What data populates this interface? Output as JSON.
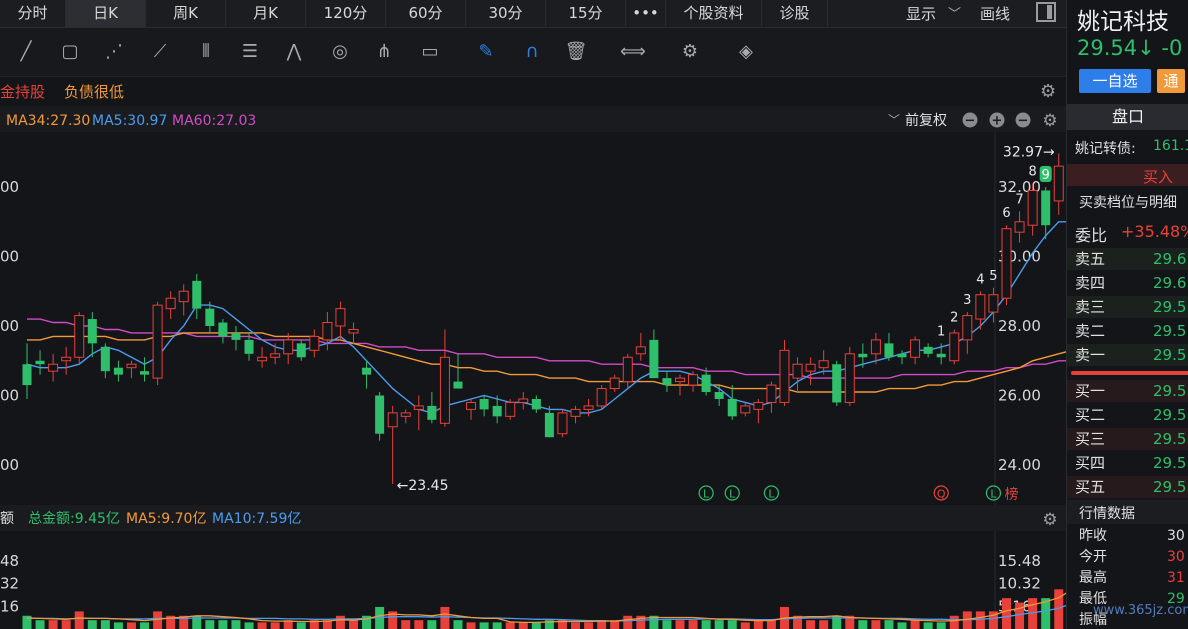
{
  "tabs": [
    {
      "label": "分时",
      "active": false
    },
    {
      "label": "日K",
      "active": true
    },
    {
      "label": "周K",
      "active": false
    },
    {
      "label": "月K",
      "active": false
    },
    {
      "label": "120分",
      "active": false
    },
    {
      "label": "60分",
      "active": false
    },
    {
      "label": "30分",
      "active": false
    },
    {
      "label": "15分",
      "active": false
    },
    {
      "label": "•••",
      "active": false
    },
    {
      "label": "个股资料",
      "active": false
    },
    {
      "label": "诊股",
      "active": false
    }
  ],
  "toolbar_right": {
    "display_label": "显示",
    "draw_label": "画线"
  },
  "tools": [
    "line-tool-icon",
    "rect-tool-icon",
    "fan-tool-icon",
    "node-tool-icon",
    "bars-tool-icon",
    "text-box-tool-icon",
    "wave-tool-icon",
    "cycle-tool-icon",
    "fork-tool-icon",
    "note-tool-icon",
    "pen-icon",
    "magnet-icon",
    "trash-icon",
    "mirror-icon",
    "settings-icon",
    "layers-icon"
  ],
  "tags": {
    "tag1": "金持股",
    "tag2": "负债很低"
  },
  "ma_legend": {
    "ma34": "MA34:27.30",
    "ma5": "MA5:30.97",
    "ma60": "MA60:27.03",
    "adjust": "前复权"
  },
  "price_axis": {
    "left": [
      "00",
      "00",
      "00",
      "00",
      "00"
    ],
    "right": [
      "32.00",
      "30.00",
      "28.00",
      "26.00",
      "24.00"
    ]
  },
  "annotations": {
    "high": "32.97→",
    "low": "←23.45",
    "seq": [
      "1",
      "2",
      "3",
      "4",
      "5",
      "6",
      "7",
      "8",
      "9"
    ],
    "markers": [
      "L",
      "L",
      "L",
      "Q",
      "L"
    ],
    "bang": "榜"
  },
  "volume": {
    "title": "额",
    "total": "总金额:9.45亿",
    "ma5": "MA5:9.70亿",
    "ma10": "MA10:7.59亿",
    "left_axis": [
      "48",
      "32",
      "16"
    ],
    "right_axis": [
      "15.48",
      "10.32",
      "5.16"
    ]
  },
  "right_panel": {
    "stock_name": "姚记科技",
    "price": "29.54↓ -0",
    "watch_button": "一自选",
    "tong": "通",
    "pankou": "盘口",
    "bond_label": "姚记转债:",
    "bond_value": "161.1",
    "buy_in": "买入",
    "depth_title": "买卖档位与明细",
    "weibi_label": "委比",
    "weibi_value": "+35.48%",
    "asks": [
      {
        "label": "卖五",
        "value": "29.6"
      },
      {
        "label": "卖四",
        "value": "29.6"
      },
      {
        "label": "卖三",
        "value": "29.5"
      },
      {
        "label": "卖二",
        "value": "29.5"
      },
      {
        "label": "卖一",
        "value": "29.5"
      }
    ],
    "bids": [
      {
        "label": "买一",
        "value": "29.5"
      },
      {
        "label": "买二",
        "value": "29.5"
      },
      {
        "label": "买三",
        "value": "29.5"
      },
      {
        "label": "买四",
        "value": "29.5"
      },
      {
        "label": "买五",
        "value": "29.5"
      }
    ],
    "stats_title": "行情数据",
    "stats": [
      {
        "label": "昨收",
        "value": "30"
      },
      {
        "label": "今开",
        "value": "30"
      },
      {
        "label": "最高",
        "value": "31"
      },
      {
        "label": "最低",
        "value": "29"
      },
      {
        "label": "振幅",
        "value": ""
      }
    ]
  },
  "watermark": "www.365jz.com",
  "colors": {
    "up": "#e8413b",
    "down": "#2fbf6b",
    "ma5": "#4a9df0",
    "ma34": "#f29a3a",
    "ma60": "#d04cc5",
    "accent": "#2d7ee8"
  },
  "chart_data": {
    "type": "candlestick",
    "candles": [
      [
        26.9,
        27.5,
        25.9,
        26.3
      ],
      [
        27.0,
        27.3,
        26.6,
        26.9
      ],
      [
        26.7,
        27.2,
        26.4,
        26.9
      ],
      [
        27.0,
        27.4,
        26.6,
        27.1
      ],
      [
        27.1,
        28.4,
        26.9,
        28.3
      ],
      [
        28.2,
        28.4,
        27.1,
        27.5
      ],
      [
        27.4,
        27.5,
        26.5,
        26.7
      ],
      [
        26.8,
        27.0,
        26.4,
        26.6
      ],
      [
        26.8,
        27.0,
        26.5,
        26.9
      ],
      [
        26.7,
        27.1,
        26.4,
        26.6
      ],
      [
        26.5,
        28.7,
        26.3,
        28.6
      ],
      [
        28.5,
        29.0,
        28.2,
        28.8
      ],
      [
        28.7,
        29.2,
        28.3,
        29.0
      ],
      [
        29.3,
        29.5,
        28.2,
        28.5
      ],
      [
        28.5,
        28.7,
        27.8,
        28.0
      ],
      [
        28.1,
        28.2,
        27.5,
        27.7
      ],
      [
        27.8,
        28.0,
        27.3,
        27.6
      ],
      [
        27.6,
        27.8,
        27.0,
        27.2
      ],
      [
        27.0,
        27.4,
        26.8,
        27.1
      ],
      [
        27.1,
        27.5,
        26.9,
        27.2
      ],
      [
        27.2,
        27.8,
        26.9,
        27.6
      ],
      [
        27.5,
        27.6,
        27.0,
        27.1
      ],
      [
        27.3,
        27.9,
        27.1,
        27.7
      ],
      [
        27.6,
        28.4,
        27.3,
        28.1
      ],
      [
        28.0,
        28.7,
        27.6,
        28.5
      ],
      [
        27.8,
        28.1,
        27.5,
        27.9
      ],
      [
        26.8,
        27.0,
        26.2,
        26.6
      ],
      [
        26.0,
        26.1,
        24.7,
        24.9
      ],
      [
        25.1,
        25.7,
        23.45,
        25.5
      ],
      [
        25.4,
        25.6,
        25.2,
        25.5
      ],
      [
        25.6,
        26.0,
        25.0,
        25.7
      ],
      [
        25.7,
        26.1,
        25.2,
        25.3
      ],
      [
        25.2,
        27.9,
        25.1,
        27.1
      ],
      [
        26.4,
        27.2,
        26.2,
        26.2
      ],
      [
        25.6,
        25.9,
        25.3,
        25.8
      ],
      [
        25.9,
        26.0,
        25.4,
        25.6
      ],
      [
        25.7,
        26.0,
        25.2,
        25.4
      ],
      [
        25.4,
        25.9,
        25.3,
        25.8
      ],
      [
        25.8,
        26.1,
        25.6,
        25.9
      ],
      [
        25.9,
        26.0,
        25.5,
        25.6
      ],
      [
        25.5,
        25.7,
        24.8,
        24.8
      ],
      [
        24.9,
        25.6,
        24.8,
        25.5
      ],
      [
        25.4,
        25.7,
        25.2,
        25.6
      ],
      [
        25.6,
        25.9,
        25.4,
        25.7
      ],
      [
        25.7,
        26.3,
        25.6,
        26.2
      ],
      [
        26.2,
        26.6,
        26.1,
        26.5
      ],
      [
        26.4,
        27.2,
        26.2,
        27.1
      ],
      [
        27.2,
        27.8,
        27.0,
        27.4
      ],
      [
        27.6,
        27.9,
        26.5,
        26.5
      ],
      [
        26.5,
        26.7,
        26.1,
        26.3
      ],
      [
        26.4,
        26.6,
        26.0,
        26.5
      ],
      [
        26.3,
        26.7,
        26.1,
        26.6
      ],
      [
        26.6,
        26.8,
        26.0,
        26.1
      ],
      [
        26.1,
        26.3,
        25.7,
        25.9
      ],
      [
        25.9,
        26.3,
        25.3,
        25.4
      ],
      [
        25.5,
        25.8,
        25.4,
        25.7
      ],
      [
        25.6,
        25.9,
        25.2,
        25.8
      ],
      [
        25.8,
        26.4,
        25.5,
        26.3
      ],
      [
        25.8,
        27.6,
        25.7,
        27.3
      ],
      [
        26.5,
        27.1,
        26.1,
        26.9
      ],
      [
        26.7,
        27.1,
        26.3,
        26.9
      ],
      [
        26.8,
        27.3,
        26.6,
        27.0
      ],
      [
        26.9,
        27.0,
        25.7,
        25.8
      ],
      [
        25.8,
        27.4,
        25.7,
        27.2
      ],
      [
        27.2,
        27.5,
        26.8,
        27.1
      ],
      [
        27.2,
        27.8,
        26.9,
        27.6
      ],
      [
        27.5,
        27.8,
        27.0,
        27.1
      ],
      [
        27.2,
        27.3,
        26.9,
        27.1
      ],
      [
        27.1,
        27.7,
        26.9,
        27.6
      ],
      [
        27.4,
        27.5,
        27.1,
        27.2
      ],
      [
        27.2,
        27.5,
        26.9,
        27.1
      ],
      [
        27.0,
        27.9,
        26.9,
        27.8
      ],
      [
        27.6,
        28.4,
        27.2,
        28.3
      ],
      [
        28.2,
        29.0,
        27.9,
        28.9
      ],
      [
        28.4,
        29.1,
        28.1,
        28.9
      ],
      [
        28.8,
        30.9,
        28.6,
        30.8
      ],
      [
        30.7,
        31.3,
        30.4,
        31.0
      ],
      [
        30.9,
        32.1,
        30.6,
        31.9
      ],
      [
        31.9,
        32.0,
        30.5,
        30.9
      ],
      [
        31.6,
        32.97,
        31.2,
        32.6
      ],
      [
        32.3,
        32.6,
        30.4,
        30.6
      ],
      [
        30.5,
        30.8,
        29.2,
        29.54
      ]
    ],
    "ma5": [
      26.9,
      26.8,
      26.8,
      26.8,
      26.9,
      27.2,
      27.4,
      27.3,
      27.1,
      26.9,
      27.1,
      27.6,
      28.0,
      28.6,
      28.6,
      28.5,
      28.2,
      27.9,
      27.6,
      27.4,
      27.3,
      27.3,
      27.4,
      27.5,
      27.7,
      27.4,
      27.0,
      26.6,
      26.2,
      25.9,
      25.6,
      25.5,
      25.7,
      25.8,
      25.9,
      26.0,
      25.9,
      25.8,
      25.8,
      25.7,
      25.6,
      25.6,
      25.5,
      25.5,
      25.6,
      25.9,
      26.2,
      26.5,
      26.7,
      26.7,
      26.7,
      26.6,
      26.4,
      26.2,
      25.9,
      25.8,
      25.7,
      25.8,
      26.1,
      26.4,
      26.6,
      26.7,
      26.7,
      26.8,
      26.9,
      27.0,
      27.1,
      27.2,
      27.3,
      27.3,
      27.4,
      27.5,
      27.7,
      28.0,
      28.4,
      28.9,
      29.5,
      30.1,
      30.6,
      31.0,
      31.0,
      30.97
    ],
    "ma34": [
      27.6,
      27.6,
      27.7,
      27.7,
      27.7,
      27.7,
      27.7,
      27.6,
      27.6,
      27.6,
      27.7,
      27.7,
      27.8,
      27.8,
      27.8,
      27.8,
      27.8,
      27.8,
      27.8,
      27.7,
      27.7,
      27.7,
      27.7,
      27.6,
      27.6,
      27.5,
      27.4,
      27.3,
      27.2,
      27.1,
      27.0,
      26.9,
      26.9,
      26.8,
      26.8,
      26.7,
      26.7,
      26.6,
      26.6,
      26.6,
      26.5,
      26.5,
      26.5,
      26.4,
      26.4,
      26.4,
      26.4,
      26.4,
      26.4,
      26.3,
      26.3,
      26.3,
      26.3,
      26.3,
      26.2,
      26.2,
      26.2,
      26.2,
      26.2,
      26.1,
      26.1,
      26.1,
      26.1,
      26.1,
      26.1,
      26.1,
      26.2,
      26.2,
      26.2,
      26.3,
      26.3,
      26.4,
      26.4,
      26.5,
      26.6,
      26.7,
      26.8,
      27.0,
      27.1,
      27.2,
      27.3,
      27.3
    ],
    "ma60": [
      28.2,
      28.2,
      28.1,
      28.1,
      28.0,
      28.0,
      27.9,
      27.9,
      27.8,
      27.8,
      27.8,
      27.8,
      27.8,
      27.7,
      27.7,
      27.7,
      27.7,
      27.7,
      27.6,
      27.6,
      27.6,
      27.6,
      27.6,
      27.5,
      27.5,
      27.5,
      27.5,
      27.4,
      27.4,
      27.4,
      27.3,
      27.3,
      27.3,
      27.2,
      27.2,
      27.2,
      27.1,
      27.1,
      27.1,
      27.1,
      27.0,
      27.0,
      27.0,
      27.0,
      26.9,
      26.9,
      26.9,
      26.9,
      26.8,
      26.8,
      26.8,
      26.8,
      26.7,
      26.7,
      26.7,
      26.6,
      26.6,
      26.6,
      26.6,
      26.6,
      26.5,
      26.5,
      26.5,
      26.5,
      26.5,
      26.5,
      26.5,
      26.6,
      26.6,
      26.6,
      26.6,
      26.6,
      26.7,
      26.7,
      26.7,
      26.8,
      26.8,
      26.9,
      26.9,
      27.0,
      27.0,
      27.03
    ],
    "volume": [
      3,
      2,
      2,
      2,
      4,
      2,
      2,
      1.5,
      1.5,
      1.5,
      4,
      3,
      3,
      3,
      2,
      2,
      2,
      1.5,
      1.5,
      1.5,
      2,
      1.5,
      2,
      2,
      3,
      2,
      3,
      5,
      4,
      2,
      2,
      2,
      5,
      2,
      1.5,
      1.5,
      1.5,
      1.5,
      1.5,
      1.5,
      2,
      2,
      1.5,
      1.5,
      2,
      2,
      3,
      3,
      3,
      2,
      2,
      2,
      2,
      2,
      2,
      1.5,
      2,
      2,
      5,
      3,
      2,
      2,
      3,
      3,
      2,
      2,
      2,
      1.5,
      2,
      1.5,
      1.5,
      3,
      4,
      4,
      4,
      7,
      6,
      7,
      7,
      9,
      15.48,
      9.45
    ],
    "vol_ma5": [
      2.5,
      2.4,
      2.3,
      2.2,
      2.5,
      2.4,
      2.4,
      2.3,
      2.1,
      1.9,
      2.2,
      2.5,
      2.7,
      3.0,
      3.0,
      2.8,
      2.6,
      2.3,
      1.9,
      1.8,
      1.8,
      1.7,
      1.7,
      1.8,
      2.1,
      2.0,
      2.3,
      3.0,
      3.4,
      3.2,
      3.2,
      3.0,
      3.4,
      3.0,
      2.6,
      2.4,
      2.4,
      1.6,
      1.5,
      1.5,
      1.6,
      1.7,
      1.7,
      1.7,
      1.8,
      1.8,
      2.1,
      2.4,
      2.6,
      2.6,
      2.6,
      2.6,
      2.4,
      2.2,
      2.2,
      2.0,
      1.9,
      1.9,
      2.5,
      2.7,
      2.8,
      2.8,
      3.0,
      2.6,
      2.5,
      2.4,
      2.3,
      2.2,
      2.0,
      1.9,
      1.8,
      1.9,
      2.2,
      2.6,
      3.1,
      4.1,
      4.7,
      5.5,
      6.2,
      7.1,
      8.9,
      9.7
    ],
    "vol_ma10": [
      2.4,
      2.4,
      2.4,
      2.3,
      2.4,
      2.4,
      2.4,
      2.3,
      2.3,
      2.3,
      2.4,
      2.4,
      2.4,
      2.5,
      2.5,
      2.5,
      2.5,
      2.4,
      2.4,
      2.4,
      2.3,
      2.3,
      2.2,
      2.2,
      2.3,
      2.3,
      2.4,
      2.6,
      2.8,
      2.8,
      2.8,
      2.7,
      2.8,
      2.7,
      2.6,
      2.5,
      2.5,
      2.4,
      2.3,
      2.2,
      2.2,
      2.1,
      2.0,
      1.9,
      1.9,
      1.8,
      1.9,
      2.0,
      2.1,
      2.2,
      2.2,
      2.2,
      2.3,
      2.3,
      2.3,
      2.2,
      2.1,
      2.1,
      2.3,
      2.4,
      2.5,
      2.5,
      2.5,
      2.5,
      2.5,
      2.4,
      2.4,
      2.4,
      2.3,
      2.2,
      2.2,
      2.1,
      2.1,
      2.2,
      2.4,
      2.8,
      3.3,
      3.7,
      4.1,
      4.7,
      5.8,
      7.59
    ],
    "seq_index": [
      70,
      71,
      72,
      73,
      74,
      75,
      76,
      77,
      78
    ],
    "marker_index": [
      52,
      54,
      57,
      70,
      74
    ],
    "marker_letters": [
      "L",
      "L",
      "L",
      "Q",
      "L"
    ],
    "price_range": [
      23,
      33
    ],
    "volume_range": [
      0,
      20.64
    ]
  }
}
